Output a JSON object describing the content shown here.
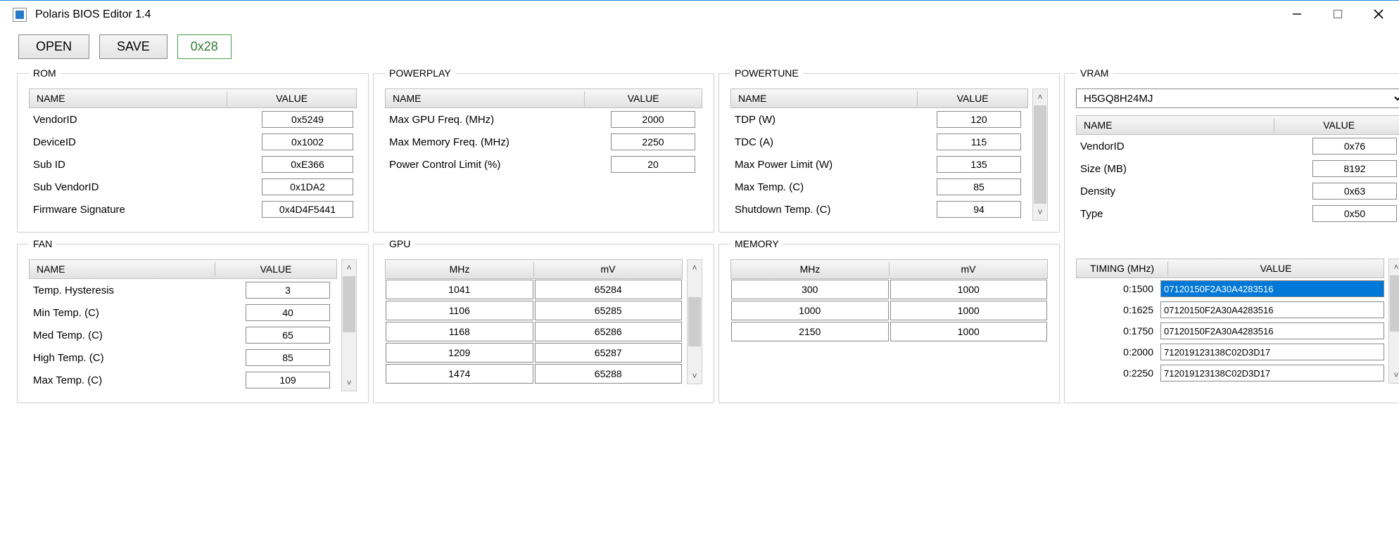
{
  "window": {
    "title": "Polaris BIOS Editor 1.4"
  },
  "toolbar": {
    "open": "OPEN",
    "save": "SAVE",
    "status": "0x28"
  },
  "rom": {
    "legend": "ROM",
    "headers": {
      "name": "NAME",
      "value": "VALUE"
    },
    "rows": [
      {
        "name": "VendorID",
        "value": "0x5249"
      },
      {
        "name": "DeviceID",
        "value": "0x1002"
      },
      {
        "name": "Sub ID",
        "value": "0xE366"
      },
      {
        "name": "Sub VendorID",
        "value": "0x1DA2"
      },
      {
        "name": "Firmware Signature",
        "value": "0x4D4F5441"
      }
    ]
  },
  "powerplay": {
    "legend": "POWERPLAY",
    "headers": {
      "name": "NAME",
      "value": "VALUE"
    },
    "rows": [
      {
        "name": "Max GPU Freq. (MHz)",
        "value": "2000"
      },
      {
        "name": "Max Memory Freq. (MHz)",
        "value": "2250"
      },
      {
        "name": "Power Control Limit (%)",
        "value": "20"
      }
    ]
  },
  "powertune": {
    "legend": "POWERTUNE",
    "headers": {
      "name": "NAME",
      "value": "VALUE"
    },
    "rows": [
      {
        "name": "TDP (W)",
        "value": "120"
      },
      {
        "name": "TDC (A)",
        "value": "115"
      },
      {
        "name": "Max Power Limit (W)",
        "value": "135"
      },
      {
        "name": "Max Temp. (C)",
        "value": "85"
      },
      {
        "name": "Shutdown Temp. (C)",
        "value": "94"
      }
    ]
  },
  "vram": {
    "legend": "VRAM",
    "selected": "H5GQ8H24MJ",
    "headers": {
      "name": "NAME",
      "value": "VALUE"
    },
    "rows": [
      {
        "name": "VendorID",
        "value": "0x76"
      },
      {
        "name": "Size (MB)",
        "value": "8192"
      },
      {
        "name": "Density",
        "value": "0x63"
      },
      {
        "name": "Type",
        "value": "0x50"
      }
    ]
  },
  "fan": {
    "legend": "FAN",
    "headers": {
      "name": "NAME",
      "value": "VALUE"
    },
    "rows": [
      {
        "name": "Temp. Hysteresis",
        "value": "3"
      },
      {
        "name": "Min Temp. (C)",
        "value": "40"
      },
      {
        "name": "Med Temp. (C)",
        "value": "65"
      },
      {
        "name": "High Temp. (C)",
        "value": "85"
      },
      {
        "name": "Max Temp. (C)",
        "value": "109"
      }
    ]
  },
  "gpu": {
    "legend": "GPU",
    "headers": {
      "mhz": "MHz",
      "mv": "mV"
    },
    "rows": [
      {
        "mhz": "1041",
        "mv": "65284"
      },
      {
        "mhz": "1106",
        "mv": "65285"
      },
      {
        "mhz": "1168",
        "mv": "65286"
      },
      {
        "mhz": "1209",
        "mv": "65287"
      },
      {
        "mhz": "1474",
        "mv": "65288"
      }
    ]
  },
  "memory": {
    "legend": "MEMORY",
    "headers": {
      "mhz": "MHz",
      "mv": "mV"
    },
    "rows": [
      {
        "mhz": "300",
        "mv": "1000"
      },
      {
        "mhz": "1000",
        "mv": "1000"
      },
      {
        "mhz": "2150",
        "mv": "1000"
      }
    ]
  },
  "timing": {
    "headers": {
      "timing": "TIMING (MHz)",
      "value": "VALUE"
    },
    "rows": [
      {
        "label": "0:1500",
        "value": "07120150F2A30A4283516",
        "selected": true
      },
      {
        "label": "0:1625",
        "value": "07120150F2A30A4283516",
        "selected": false
      },
      {
        "label": "0:1750",
        "value": "07120150F2A30A4283516",
        "selected": false
      },
      {
        "label": "0:2000",
        "value": "712019123138C02D3D17",
        "selected": false
      },
      {
        "label": "0:2250",
        "value": "712019123138C02D3D17",
        "selected": false
      }
    ]
  }
}
